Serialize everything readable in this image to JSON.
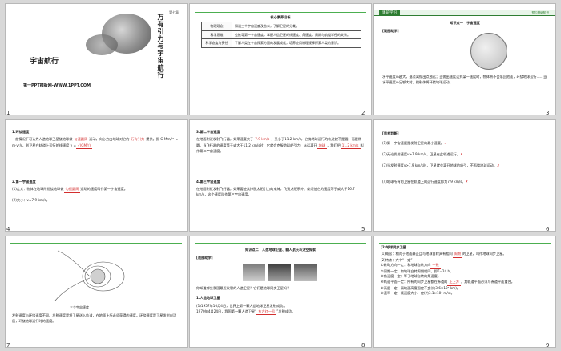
{
  "slides": [
    {
      "num": "1",
      "title": "宇宙航行",
      "vertical_title": "万有引力与宇宙航行",
      "chapter_tag": "第七章",
      "watermark": "第一PPT模板网-WWW.1PPT.COM"
    },
    {
      "num": "2",
      "table_title": "核心素养目标",
      "rows": [
        {
          "k": "物理观念",
          "v": "知道三个宇宙速度及含义，了解卫星的分类。"
        },
        {
          "k": "科学思维",
          "v": "会推导第一宇宙速度，掌握人造卫星的线速度、角速度、周期与轨道半径的关系。"
        },
        {
          "k": "科学态度与责任",
          "v": "了解人类在宇宙探索方面的发展成就，培养应用物理规律探索人类的意识。"
        }
      ]
    },
    {
      "num": "3",
      "header": "课前学习",
      "header_right": "预习基础知识",
      "knowledge": "知识点一　宇宙速度",
      "section": "[观图助学]",
      "body": "水平速度v₀越大，落点离抛出点越远；当抛出速度达到某一速度时，物体将不会落回地面，环绕地球运行……当水平速度v₀足够大时，抛射体将环绕地球运动。"
    },
    {
      "num": "4",
      "heading": "1.环绕速度",
      "p1": "一般情况下可认为人造地球卫星绕地球做",
      "b1": "匀速圆周",
      "p1b": "运动，向心力由地球对它的",
      "b2": "万有引力",
      "p1c": "提供。即 G·Mm/r² = m·v²/r，则卫星在轨道上运行的线速度 v =",
      "formula": "√(GM/r)",
      "h2": "2.第一宇宙速度",
      "d1": "(1)定义：物体在地球附近绕地球做",
      "b3": "匀速圆周",
      "d1b": "运动的速度叫作第一宇宙速度。",
      "d2": "(2)大小：v=7.9 km/s。"
    },
    {
      "num": "5",
      "h3": "3.第二宇宙速度",
      "p": "在地面附近发射飞行器，如果速度大于",
      "b1": "7.9 km/s",
      "p2": "，又小于11.2 km/s，它绕地球运行的轨迹就不是圆，而是椭圆。当飞行器的速度等于或大于11.2 km/s时，它就会克服地球的引力，永远离开",
      "b2": "地球",
      "p3": "，我们把",
      "b3": "11.2 km/s",
      "p4": "叫作第二宇宙速度。",
      "h4": "4.第三宇宙速度",
      "q": "在地面附近发射飞行器，如果要使其挣脱太阳引力的束缚，飞到太阳系外，必须使它的速度等于或大于16.7 km/s，这个速度叫作第三宇宙速度。"
    },
    {
      "num": "6",
      "section": "[思考判断]",
      "items": [
        {
          "t": "(1)第一宇宙速度是发射卫星的最小速度。",
          "mark": "✓"
        },
        {
          "t": "(2)无论发射速度v>7.9 km/s，卫星在此轨道运行。",
          "mark": "✗"
        },
        {
          "t": "(3)当发射速度v>7.9 km/s时，卫星就会离开地球的吸引，不再绕地球运动。",
          "mark": "✗"
        },
        {
          "t": "(4)地球所有的卫星在轨道上的运行速度都为7.9 km/s。",
          "mark": "✗"
        }
      ]
    },
    {
      "num": "7",
      "caption": "三个宇宙速度",
      "body": "发射速度与环绕速度不同。发射速度是将卫星送入轨道，在地面上所必须获得的速度。环绕速度是卫星发射成功后，环绕地球运行时的速度。"
    },
    {
      "num": "8",
      "knowledge": "知识点二　人造地球卫星、载人航天与太空探索",
      "section": "[观图助学]",
      "question": "你知道哪些我国最近发射的人造卫星？它们是地球同步卫星吗？",
      "h1": "1.人造地球卫星",
      "p": "(1)1957年10月4日，世界上第一颗人造地球卫星发射成功。",
      "p2": "1970年4月24日，我国第一颗人造卫星“",
      "b": "东方红一号",
      "p3": "”发射成功。"
    },
    {
      "num": "9",
      "h": "(2)地球同步卫星",
      "l1": "(1)概念：相对于地面静止且与地球自转具有相同",
      "b1": "周期",
      "l1b": "的卫星，叫作地球同步卫星。",
      "l2": "(2)特点：六个“一定”",
      "l3": "①转动方向一定：和地球自转方向",
      "b2": "一致",
      "l4": "②周期一定：和地球自转周期相同，即T=24 h。",
      "l5": "③角速度一定：等于地球自转的角速度。",
      "l6": "④轨道平面一定：所有的同步卫星都在赤道的",
      "b3": "正上方",
      "l6b": "，其轨道平面必须与赤道平面重合。",
      "l7": "⑤高度一定：离地面高度固定不变(约3.6×10⁴ km)。",
      "l8": "⑥速率一定：线速度大小一定(约3.1×10³ m/s)。"
    }
  ],
  "colors": {
    "accent": "#2e7d32",
    "red": "#d32f2f",
    "background": "#d8d8d8"
  }
}
